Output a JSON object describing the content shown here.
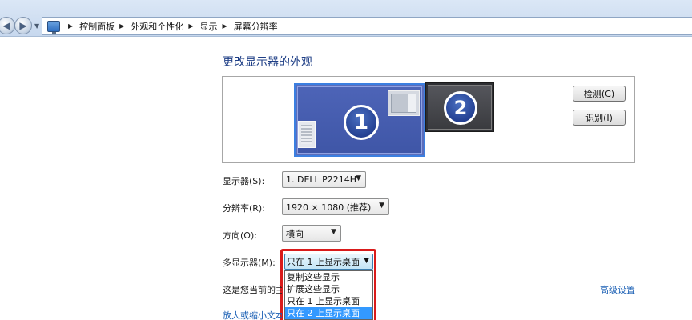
{
  "address_bar": {
    "breadcrumbs": [
      "控制面板",
      "外观和个性化",
      "显示",
      "屏幕分辨率"
    ]
  },
  "page": {
    "title": "更改显示器的外观"
  },
  "preview": {
    "monitor1_number": "1",
    "monitor2_number": "2",
    "detect_label": "检测(C)",
    "identify_label": "识别(I)"
  },
  "form": {
    "display_label": "显示器(S):",
    "display_value": "1. DELL P2214H",
    "resolution_label": "分辨率(R):",
    "resolution_value": "1920 × 1080 (推荐)",
    "orientation_label": "方向(O):",
    "orientation_value": "横向",
    "multi_label": "多显示器(M):",
    "multi_value": "只在 1 上显示桌面",
    "multi_options": [
      "复制这些显示",
      "扩展这些显示",
      "只在 1 上显示桌面",
      "只在 2 上显示桌面"
    ],
    "multi_selected_index": 3
  },
  "footer": {
    "current_text": "这是您当前的主",
    "advanced_link": "高级设置",
    "zoom_link": "放大或缩小文本"
  },
  "colors": {
    "highlight_border": "#d91b1b",
    "selected_option": "#3399ff",
    "link": "#1a5fb4",
    "title": "#1f3f86"
  }
}
